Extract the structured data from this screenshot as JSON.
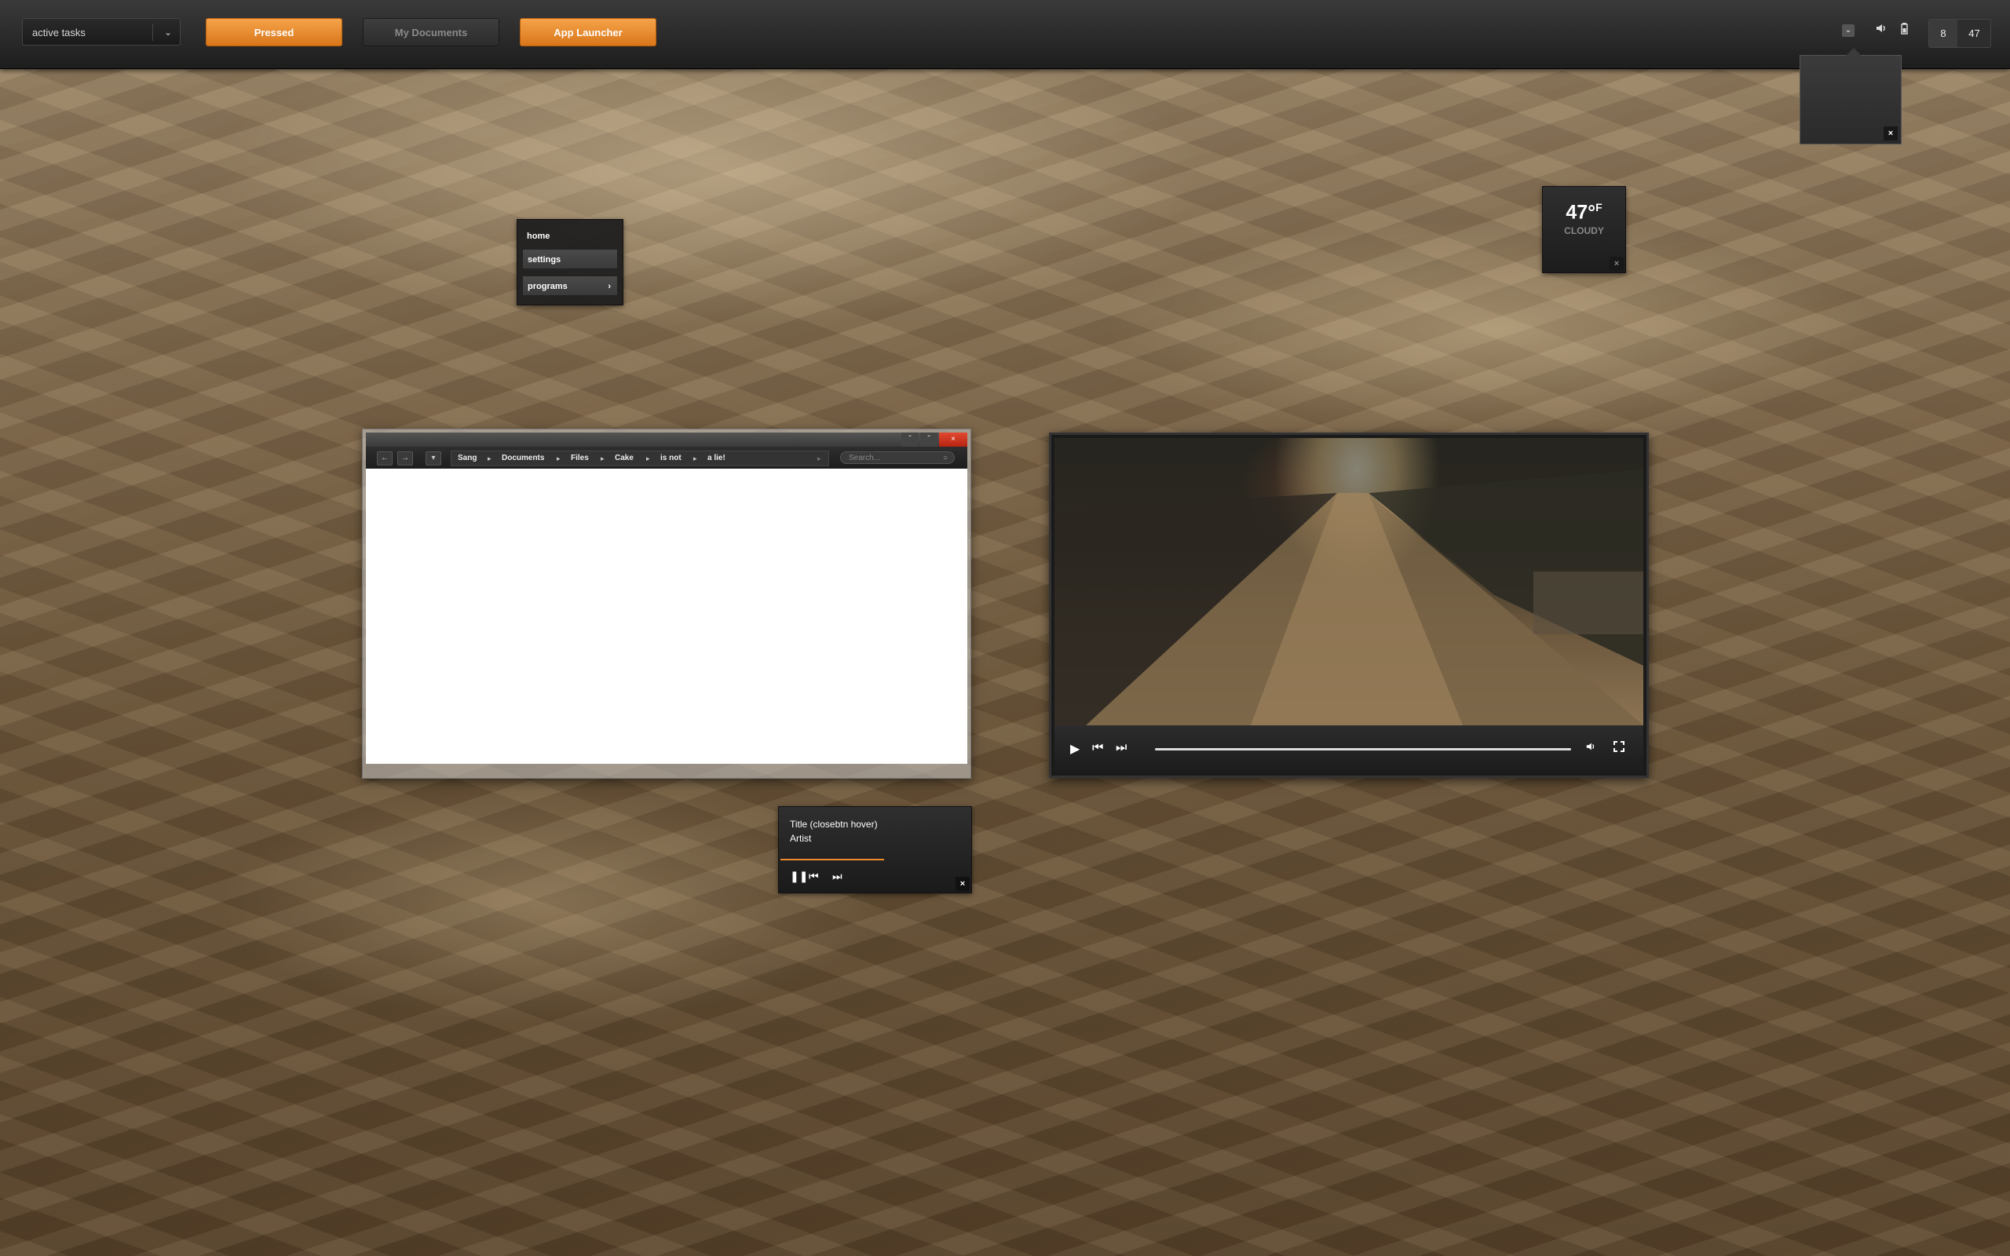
{
  "panel": {
    "tasks_label": "active tasks",
    "buttons": [
      {
        "label": "Pressed"
      },
      {
        "label": "My Documents"
      },
      {
        "label": "App Launcher"
      }
    ],
    "tray_icons": [
      "chevron-down-icon",
      "volume-icon",
      "battery-icon"
    ],
    "clock": {
      "hour": "8",
      "minute": "47"
    }
  },
  "menu": {
    "items": [
      {
        "label": "home"
      },
      {
        "label": "settings"
      },
      {
        "label": "programs"
      }
    ]
  },
  "weather": {
    "temp": "47°",
    "unit": "F",
    "condition": "CLOUDY"
  },
  "file_manager": {
    "breadcrumbs": [
      "Sang",
      "Documents",
      "Files",
      "Cake",
      "is not",
      "a lie!"
    ],
    "search_placeholder": "Search..."
  },
  "mini_player": {
    "title": "Title (closebtn hover)",
    "artist": "Artist",
    "progress": 0.55
  },
  "colors": {
    "accent": "#e88a2c",
    "close": "#d2351c"
  }
}
